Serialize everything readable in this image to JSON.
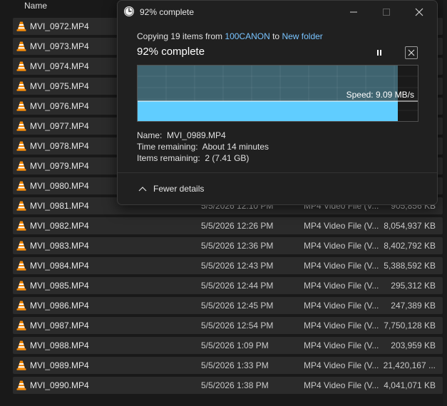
{
  "explorer": {
    "column_name": "Name",
    "rows": [
      {
        "name": "MVI_0972.MP4",
        "date": "",
        "type": "",
        "size": ""
      },
      {
        "name": "MVI_0973.MP4",
        "date": "",
        "type": "",
        "size": ""
      },
      {
        "name": "MVI_0974.MP4",
        "date": "",
        "type": "",
        "size": ""
      },
      {
        "name": "MVI_0975.MP4",
        "date": "",
        "type": "",
        "size": ""
      },
      {
        "name": "MVI_0976.MP4",
        "date": "",
        "type": "",
        "size": ""
      },
      {
        "name": "MVI_0977.MP4",
        "date": "",
        "type": "",
        "size": ""
      },
      {
        "name": "MVI_0978.MP4",
        "date": "",
        "type": "",
        "size": ""
      },
      {
        "name": "MVI_0979.MP4",
        "date": "",
        "type": "",
        "size": ""
      },
      {
        "name": "MVI_0980.MP4",
        "date": "",
        "type": "",
        "size": ""
      },
      {
        "name": "MVI_0981.MP4",
        "date": "5/5/2026 12:10 PM",
        "type": "MP4 Video File (V...",
        "size": "905,856 KB"
      },
      {
        "name": "MVI_0982.MP4",
        "date": "5/5/2026 12:26 PM",
        "type": "MP4 Video File (V...",
        "size": "8,054,937 KB"
      },
      {
        "name": "MVI_0983.MP4",
        "date": "5/5/2026 12:36 PM",
        "type": "MP4 Video File (V...",
        "size": "8,402,792 KB"
      },
      {
        "name": "MVI_0984.MP4",
        "date": "5/5/2026 12:43 PM",
        "type": "MP4 Video File (V...",
        "size": "5,388,592 KB"
      },
      {
        "name": "MVI_0985.MP4",
        "date": "5/5/2026 12:44 PM",
        "type": "MP4 Video File (V...",
        "size": "295,312 KB"
      },
      {
        "name": "MVI_0986.MP4",
        "date": "5/5/2026 12:45 PM",
        "type": "MP4 Video File (V...",
        "size": "247,389 KB"
      },
      {
        "name": "MVI_0987.MP4",
        "date": "5/5/2026 12:54 PM",
        "type": "MP4 Video File (V...",
        "size": "7,750,128 KB"
      },
      {
        "name": "MVI_0988.MP4",
        "date": "5/5/2026 1:09 PM",
        "type": "MP4 Video File (V...",
        "size": "203,959 KB"
      },
      {
        "name": "MVI_0989.MP4",
        "date": "5/5/2026 1:33 PM",
        "type": "MP4 Video File (V...",
        "size": "21,420,167 ..."
      },
      {
        "name": "MVI_0990.MP4",
        "date": "5/5/2026 1:38 PM",
        "type": "MP4 Video File (V...",
        "size": "4,041,071 KB"
      }
    ]
  },
  "dialog": {
    "title": "92% complete",
    "copy_prefix": "Copying 19 items from ",
    "source": "100CANON",
    "copy_mid": " to ",
    "destination": "New folder",
    "percent_label": "92% complete",
    "percent": 92,
    "speed_label": "Speed: 9.09 MB/s",
    "name_label": "Name:",
    "name_value": "MVI_0989.MP4",
    "time_label": "Time remaining:",
    "time_value": "About 14 minutes",
    "items_label": "Items remaining:",
    "items_value": "2 (7.41 GB)",
    "fewer_details": "Fewer details"
  },
  "colors": {
    "accent": "#60cdff",
    "link": "#79c4ff",
    "graph_fill": "#3f6470",
    "vlc_orange": "#f28a0b"
  }
}
